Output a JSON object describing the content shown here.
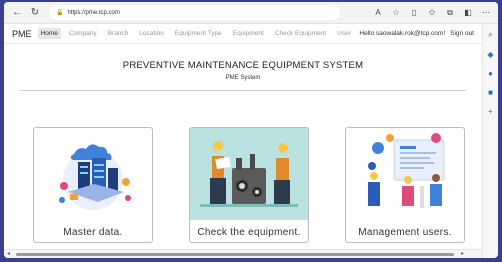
{
  "browser": {
    "url": "https://pme.tcp.com",
    "icons": [
      "back-icon",
      "refresh-icon",
      "lock-icon",
      "read-aloud-icon",
      "favorite-icon",
      "split-screen-icon",
      "favorites-bar-icon",
      "collections-icon",
      "extensions-icon",
      "more-icon"
    ]
  },
  "nav": {
    "brand": "PME",
    "links": [
      "Home",
      "Company",
      "Branch",
      "Location",
      "Equipment Type",
      "Equipment",
      "Check Equipment",
      "User"
    ],
    "active": "Home",
    "greeting": "Hello saowalak.rok@tcp.com!",
    "signout": "Sign out"
  },
  "page": {
    "title": "PREVENTIVE MAINTENANCE EQUIPMENT SYSTEM",
    "subtitle": "PME System"
  },
  "cards": [
    {
      "label": "Master data.",
      "icon": "server-cloud-illustration"
    },
    {
      "label": "Check the equipment.",
      "icon": "engineers-machine-illustration"
    },
    {
      "label": "Management users.",
      "icon": "team-dashboard-illustration"
    }
  ],
  "colors": {
    "card_bg_teal": "#b9e2e0",
    "window_frame": "#3a3f8f"
  }
}
